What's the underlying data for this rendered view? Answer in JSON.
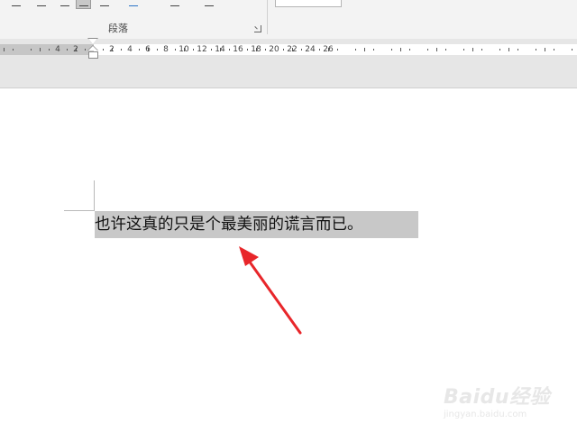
{
  "ribbon": {
    "paragraph_group_label": "段落"
  },
  "ruler": {
    "left_labels": [
      "4",
      "2"
    ],
    "right_labels": [
      "2",
      "4",
      "6",
      "8",
      "10",
      "12",
      "14",
      "16",
      "18",
      "20",
      "22",
      "24",
      "26"
    ]
  },
  "document": {
    "selected_text": "也许这真的只是个最美丽的谎言而已。"
  },
  "watermark": {
    "logo": "Baidu经验",
    "url": "jingyan.baidu.com"
  },
  "colors": {
    "selection": "#c8c8c8",
    "arrow": "#e8262a",
    "ruler_margin": "#c6c6c6"
  }
}
